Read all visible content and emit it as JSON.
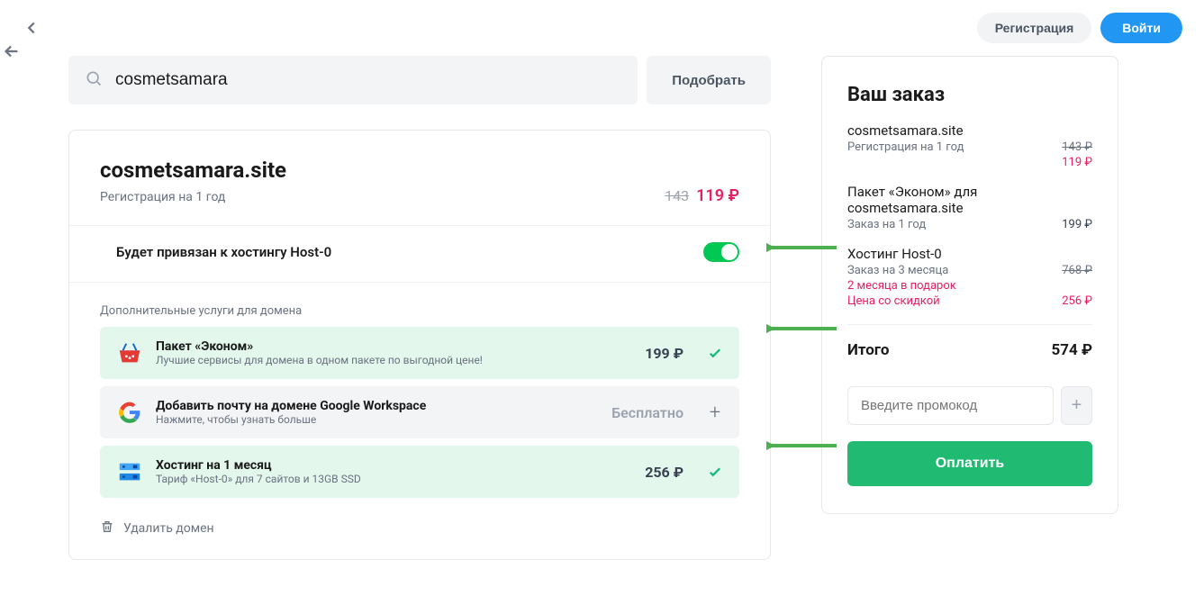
{
  "header": {
    "register_label": "Регистрация",
    "login_label": "Войти"
  },
  "search": {
    "value": "cosmetsamara",
    "button_label": "Подобрать"
  },
  "domain": {
    "name": "cosmetsamara.site",
    "reg_label": "Регистрация на 1 год",
    "old_price": "143",
    "new_price": "119 ₽",
    "bind_label": "Будет привязан к хостингу Host-0",
    "addons_caption": "Дополнительные услуги для домена",
    "addons": [
      {
        "title": "Пакет «Эконом»",
        "desc": "Лучшие сервисы для домена в одном пакете по выгодной цене!",
        "price": "199 ₽",
        "selected": true
      },
      {
        "title": "Добавить почту на домене Google Workspace",
        "desc": "Нажмите, чтобы узнать больше",
        "price": "Бесплатно",
        "selected": false
      },
      {
        "title": "Хостинг на 1 месяц",
        "desc": "Тариф «Host-0» для 7 сайтов и 13GB SSD",
        "price": "256 ₽",
        "selected": true
      }
    ],
    "delete_label": "Удалить домен"
  },
  "cart": {
    "title": "Ваш заказ",
    "domain_name": "cosmetsamara.site",
    "reg_label": "Регистрация на 1 год",
    "reg_old": "143 ₽",
    "reg_new": "119 ₽",
    "package_label": "Пакет «Эконом» для cosmetsamara.site",
    "package_sub": "Заказ на 1 год",
    "package_price": "199 ₽",
    "hosting_label": "Хостинг Host-0",
    "hosting_sub": "Заказ на 3 месяца",
    "hosting_old": "768 ₽",
    "hosting_bonus": "2 месяца в подарок",
    "hosting_discount_label": "Цена со скидкой",
    "hosting_discount": "256 ₽",
    "total_label": "Итого",
    "total_value": "574 ₽",
    "promo_placeholder": "Введите промокод",
    "pay_label": "Оплатить"
  }
}
